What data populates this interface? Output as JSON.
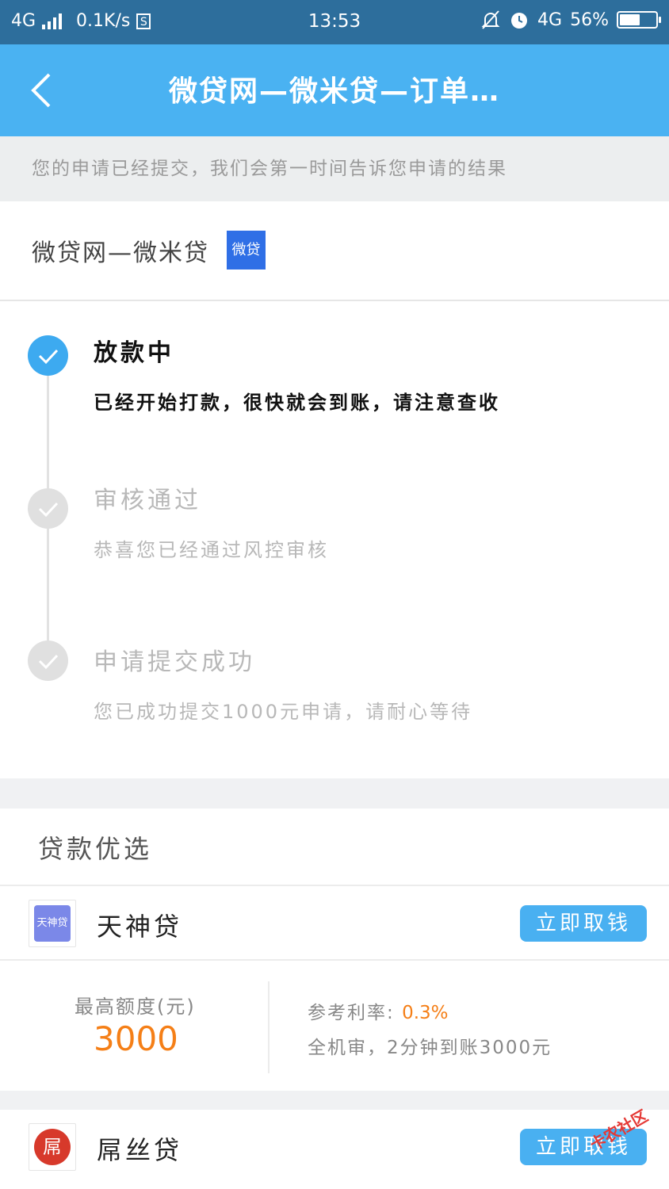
{
  "status_bar": {
    "network": "4G",
    "speed": "0.1K/s",
    "s_badge": "S",
    "time": "13:53",
    "network_right": "4G",
    "battery": "56%",
    "battery_level": 0.56
  },
  "nav": {
    "title": "微贷网—微米贷—订单…"
  },
  "notice": "您的申请已经提交，我们会第一时间告诉您申请的结果",
  "product": {
    "name": "微贷网—微米贷",
    "logo_text": "微贷"
  },
  "steps": [
    {
      "title": "放款中",
      "desc": "已经开始打款，很快就会到账，请注意查收",
      "state": "active"
    },
    {
      "title": "审核通过",
      "desc": "恭喜您已经通过风控审核",
      "state": "inactive"
    },
    {
      "title": "申请提交成功",
      "desc": "您已成功提交1000元申请，请耐心等待",
      "state": "inactive"
    }
  ],
  "recommend": {
    "title": "贷款优选",
    "lenders": [
      {
        "name": "天神贷",
        "logo_text": "天神贷",
        "button": "立即取钱",
        "limit_label": "最高额度(元)",
        "limit_value": "3000",
        "rate_label": "参考利率:",
        "rate_value": "0.3%",
        "note": "全机审，2分钟到账3000元"
      },
      {
        "name": "屌丝贷",
        "logo_text": "屌",
        "button": "立即取钱"
      }
    ]
  },
  "watermark": "卡农社区",
  "colors": {
    "status_bar": "#2d6e9c",
    "nav": "#4ab2f2",
    "accent": "#3daaf0",
    "button": "#49b0f1",
    "highlight": "#f57f17"
  }
}
